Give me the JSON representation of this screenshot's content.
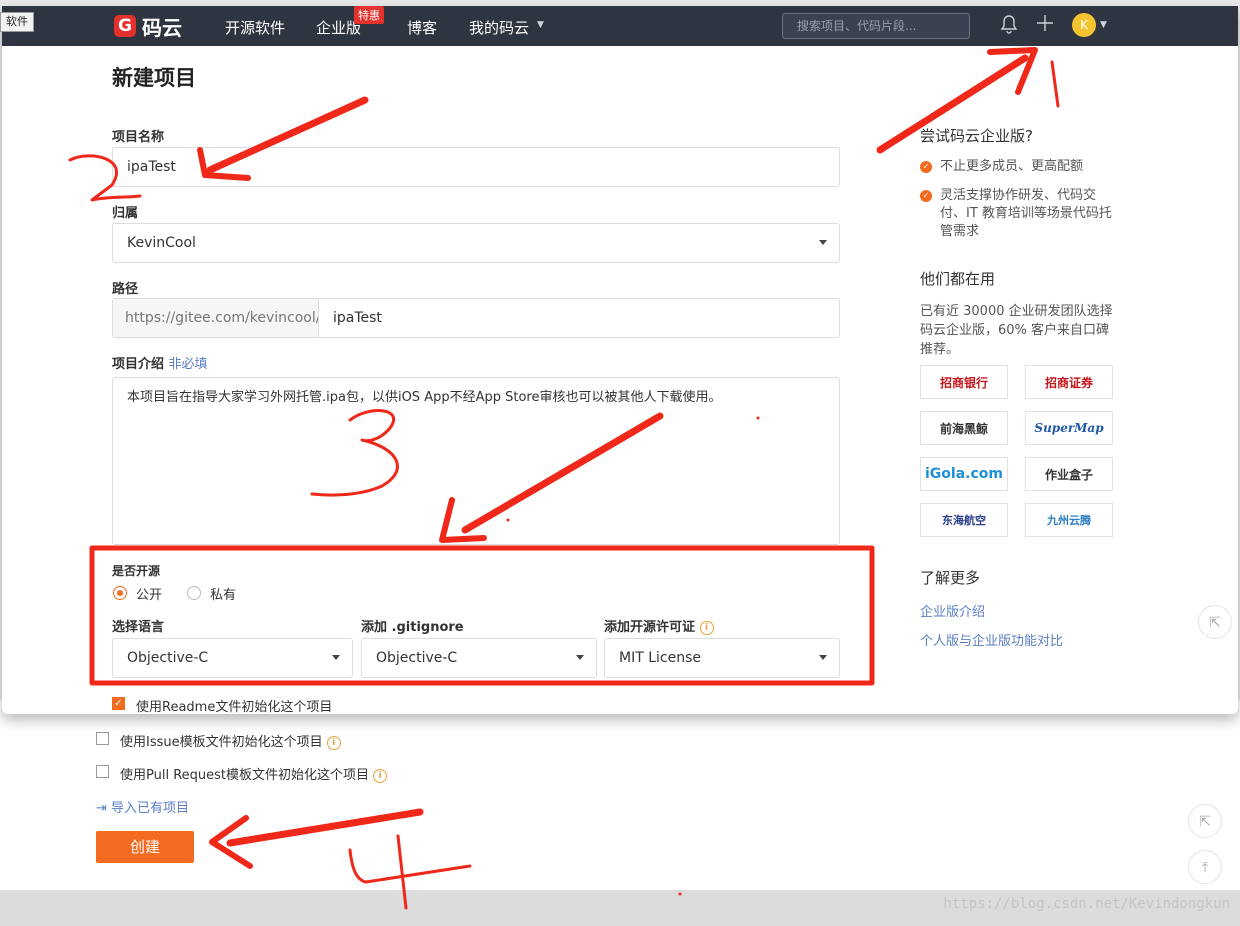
{
  "corner_tag": "软件",
  "header": {
    "logo": "码云",
    "nav": [
      "开源软件",
      "企业版",
      "博客",
      "我的码云"
    ],
    "badge": "特惠",
    "search_placeholder": "搜索项目、代码片段...",
    "avatar_letter": "K",
    "icons": [
      "bell-icon",
      "plus-icon",
      "chevron-down-icon"
    ]
  },
  "form": {
    "title": "新建项目",
    "name_label": "项目名称",
    "name_value": "ipaTest",
    "owner_label": "归属",
    "owner_value": "KevinCool",
    "path_label": "路径",
    "path_prefix": "https://gitee.com/kevincool/",
    "path_value": "ipaTest",
    "desc_label": "项目介绍",
    "desc_optional": "非必填",
    "desc_value": "本项目旨在指导大家学习外网托管.ipa包，以供iOS App不经App Store审核也可以被其他人下载使用。",
    "open_label": "是否开源",
    "public_label": "公开",
    "private_label": "私有",
    "lang_label": "选择语言",
    "lang_value": "Objective-C",
    "gitignore_label": "添加 .gitignore",
    "gitignore_value": "Objective-C",
    "license_label": "添加开源许可证",
    "license_value": "MIT License",
    "readme_label": "使用Readme文件初始化这个项目",
    "issue_label": "使用Issue模板文件初始化这个项目",
    "pr_label": "使用Pull Request模板文件初始化这个项目",
    "import_label": "导入已有项目",
    "create_label": "创建"
  },
  "sidebar": {
    "try_title": "尝试码云企业版?",
    "bullets": [
      "不止更多成员、更高配额",
      "灵活支撑协作研发、代码交付、IT 教育培训等场景代码托管需求"
    ],
    "using_title": "他们都在用",
    "using_text": "已有近 30000 企业研发团队选择码云企业版，60% 客户来自口碑推荐。",
    "logos": [
      "招商银行",
      "招商证券",
      "前海黑鲸",
      "SuperMap",
      "iGola.com",
      "作业盒子",
      "东海航空",
      "九州云腾"
    ],
    "more_title": "了解更多",
    "links": [
      "企业版介绍",
      "个人版与企业版功能对比"
    ]
  },
  "annotations": [
    "1",
    "2",
    "3",
    "4"
  ],
  "watermark": "https://blog.csdn.net/Kevindongkun",
  "colors": {
    "accent": "#f26b21",
    "header": "#2e3440",
    "annotation": "#f0281a"
  }
}
